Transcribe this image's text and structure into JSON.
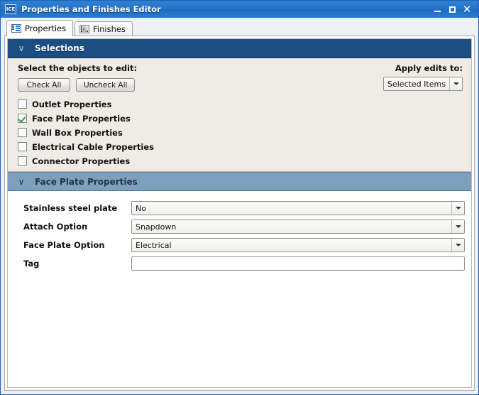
{
  "window": {
    "title": "Properties and Finishes Editor",
    "app_icon": "ICE",
    "minimize_label": "Minimize",
    "maximize_label": "Maximize",
    "close_label": "Close",
    "close_glyph": "✕"
  },
  "tabs": [
    {
      "label": "Properties",
      "icon": "list-icon",
      "active": true
    },
    {
      "label": "Finishes",
      "icon": "color-swatch-grid-icon",
      "active": false
    }
  ],
  "selections_section": {
    "title": "Selections",
    "chevron": "∨",
    "prompt": "Select the objects to edit:",
    "check_all_label": "Check All",
    "uncheck_all_label": "Uncheck All",
    "apply_label": "Apply edits to:",
    "apply_value": "Selected Items",
    "apply_options": [
      "Selected Items"
    ],
    "items": [
      {
        "label": "Outlet Properties",
        "checked": false
      },
      {
        "label": "Face Plate Properties",
        "checked": true
      },
      {
        "label": "Wall Box Properties",
        "checked": false
      },
      {
        "label": "Electrical Cable Properties",
        "checked": false
      },
      {
        "label": "Connector Properties",
        "checked": false
      }
    ]
  },
  "face_plate_section": {
    "title": "Face Plate Properties",
    "chevron": "∨",
    "fields": [
      {
        "label": "Stainless steel plate",
        "value": "No",
        "type": "combo",
        "placeholder": ""
      },
      {
        "label": "Attach Option",
        "value": "Snapdown",
        "type": "combo",
        "placeholder": ""
      },
      {
        "label": "Face Plate Option",
        "value": "Electrical",
        "type": "combo",
        "placeholder": ""
      },
      {
        "label": "Tag",
        "value": "",
        "type": "text",
        "placeholder": ""
      }
    ]
  },
  "colors": {
    "titlebar_blue": "#2576cb",
    "window_border": "#3a82d8",
    "section_header_dark": "#1d4e82",
    "section_header_light": "#7ea0bf",
    "selections_background": "#efece6",
    "checkmark_green": "#2f9b2f"
  },
  "swatch_colors": [
    "#6f4ea8",
    "#c8c6cb",
    "#e0dee3",
    "#f0eef3",
    "#1f6fa8",
    "#2f8f4f",
    "#b8b6bb",
    "#e9e7ec",
    "#8b1c1c",
    "#d4a017",
    "#e07820",
    "#7030a0"
  ]
}
